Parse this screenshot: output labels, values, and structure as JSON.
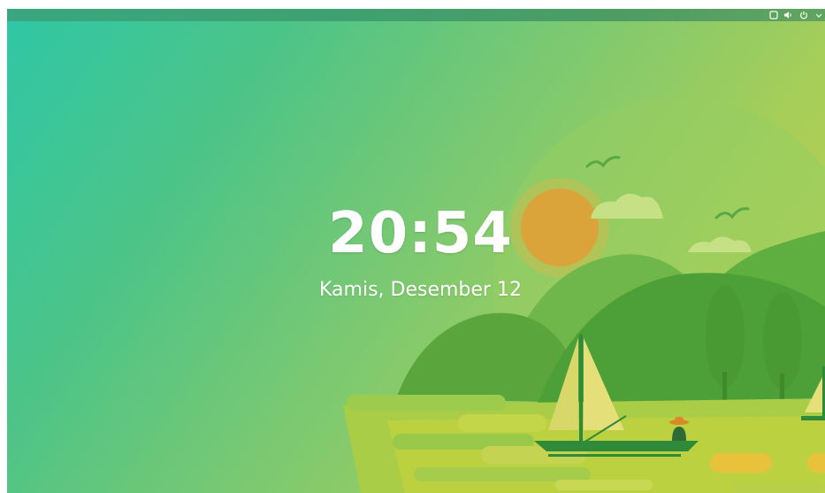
{
  "lockscreen": {
    "time": "20:54",
    "date": "Kamis, Desember 12"
  },
  "tray": {
    "icons": [
      "window-icon",
      "volume-icon",
      "power-icon",
      "chevron-down-icon"
    ]
  },
  "colors": {
    "topbar": "#3e9e6e",
    "sky_start": "#2fc7a6",
    "sky_end": "#c8d24a",
    "hill_dark": "#5aaa3c",
    "hill_light": "#86bf45",
    "sun": "#dba43a",
    "water": "#bcd13f",
    "text": "#ffffff"
  }
}
